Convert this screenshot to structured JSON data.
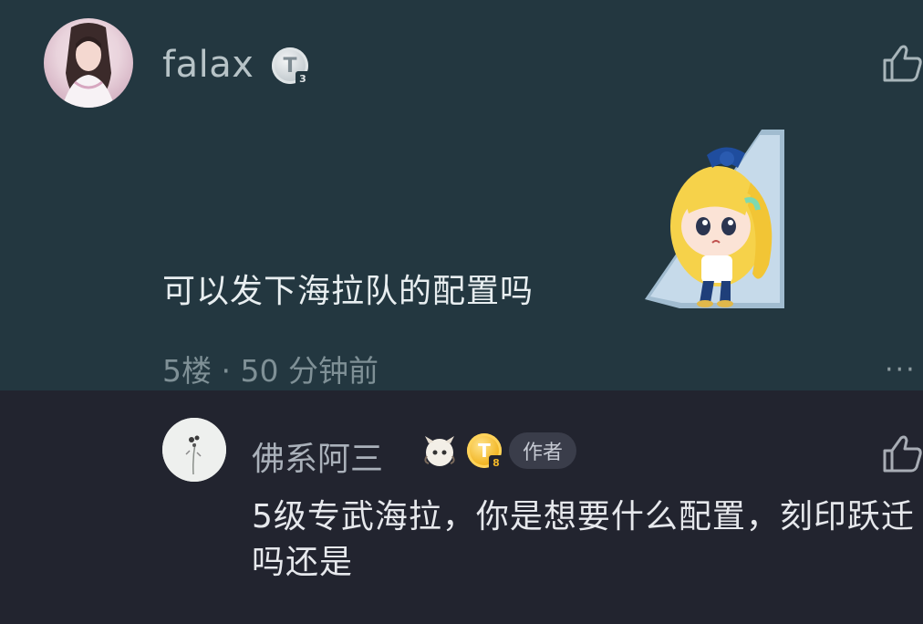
{
  "comment": {
    "username": "falax",
    "level_badge": {
      "letter": "T",
      "level": "3",
      "color": "#c8cfd3"
    },
    "text": "可以发下海拉队的配置吗",
    "meta": "5楼 · 50 分钟前",
    "icons": {
      "like": "thumbs-up-icon",
      "more": "more-dots-icon"
    },
    "sticker": "anime-girl-sticker"
  },
  "reply": {
    "username": "佛系阿三",
    "level_badge": {
      "letter": "T",
      "level": "8",
      "color": "#f2b728"
    },
    "author_tag": "作者",
    "text": "5级专武海拉，你是想要什么配置，刻印跃迁吗还是",
    "icons": {
      "like": "thumbs-up-icon",
      "character_badge": "character-badge-icon"
    }
  },
  "colors": {
    "comment_bg": "#233740",
    "reply_bg": "#22242f",
    "text_primary": "#e8eef0",
    "text_secondary": "#7f9096"
  }
}
